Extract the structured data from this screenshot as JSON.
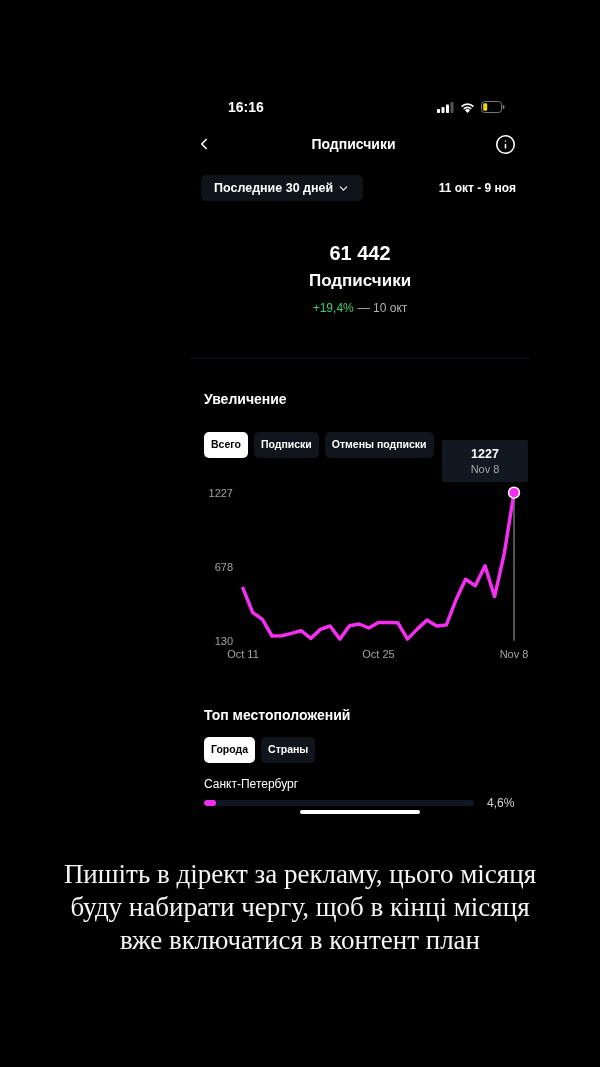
{
  "status_bar": {
    "time": "16:16"
  },
  "header": {
    "title": "Подписчики"
  },
  "range": {
    "label": "Последние 30 дней",
    "dates": "11 окт - 9 ноя"
  },
  "summary": {
    "total": "61 442",
    "label": "Подписчики",
    "change": "+19,4%",
    "since": "— 10 окт"
  },
  "growth": {
    "title": "Увеличение",
    "tabs": [
      {
        "label": "Всего",
        "selected": true
      },
      {
        "label": "Подписки",
        "selected": false
      },
      {
        "label": "Отмены подписки",
        "selected": false
      }
    ],
    "tooltip": {
      "value": "1227",
      "date": "Nov 8"
    },
    "chart_data": {
      "type": "line",
      "categories": [
        "Oct 11",
        null,
        null,
        null,
        null,
        null,
        null,
        null,
        null,
        null,
        null,
        null,
        null,
        null,
        "Oct 25",
        null,
        null,
        null,
        null,
        null,
        null,
        null,
        null,
        null,
        null,
        null,
        null,
        null,
        "Nov 8"
      ],
      "yticks": [
        130,
        678,
        1227
      ],
      "ylim": [
        130,
        1227
      ],
      "series": [
        {
          "color": "#f52ff0",
          "values": [
            518,
            338,
            288,
            165,
            167,
            184,
            204,
            147,
            214,
            239,
            142,
            241,
            254,
            224,
            266,
            266,
            263,
            142,
            216,
            283,
            239,
            246,
            431,
            585,
            538,
            686,
            456,
            777,
            1227
          ]
        }
      ]
    }
  },
  "locations": {
    "title": "Топ местоположений",
    "tabs": [
      {
        "label": "Города",
        "selected": true
      },
      {
        "label": "Страны",
        "selected": false
      }
    ],
    "items": [
      {
        "name": "Санкт-Петербург",
        "level": 0.046,
        "reading": "4,6%"
      }
    ]
  },
  "caption": "Пишіть в дірект за рекламу, цього місяця буду набирати чергу, щоб в кінці місяця вже включатися в контент план"
}
